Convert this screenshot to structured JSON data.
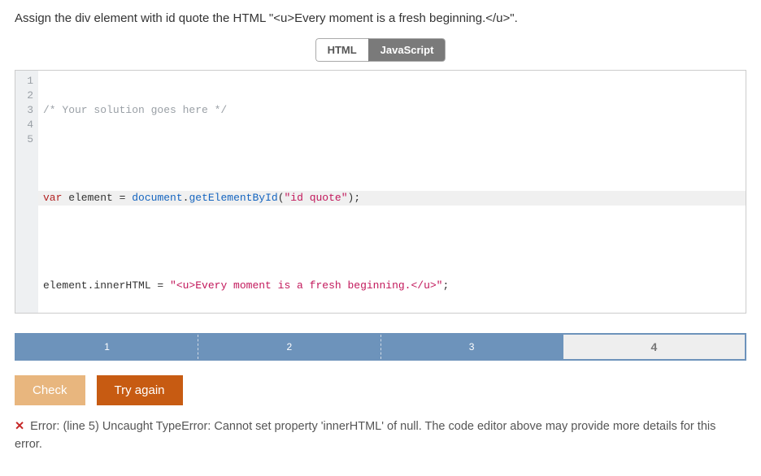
{
  "instruction": "Assign the div element with id quote the HTML \"<u>Every moment is a fresh beginning.</u>\".",
  "tabs": {
    "html": "HTML",
    "js": "JavaScript"
  },
  "code": {
    "lines": [
      "1",
      "2",
      "3",
      "4",
      "5"
    ],
    "l1_comment": "/* Your solution goes here */",
    "l3_kw": "var",
    "l3_a": " element = ",
    "l3_doc": "document",
    "l3_dot": ".",
    "l3_fn": "getElementById",
    "l3_paren_open": "(",
    "l3_str": "\"id quote\"",
    "l3_paren_close": ");",
    "l5_a": "element.innerHTML = ",
    "l5_str": "\"<u>Every moment is a fresh beginning.</u>\"",
    "l5_semi": ";"
  },
  "steps": [
    "1",
    "2",
    "3",
    "4"
  ],
  "active_step": 3,
  "buttons": {
    "check": "Check",
    "try": "Try again"
  },
  "error": {
    "x": "✕",
    "text": " Error: (line 5) Uncaught TypeError: Cannot set property 'innerHTML' of null. The code editor above may provide more details for this error."
  }
}
